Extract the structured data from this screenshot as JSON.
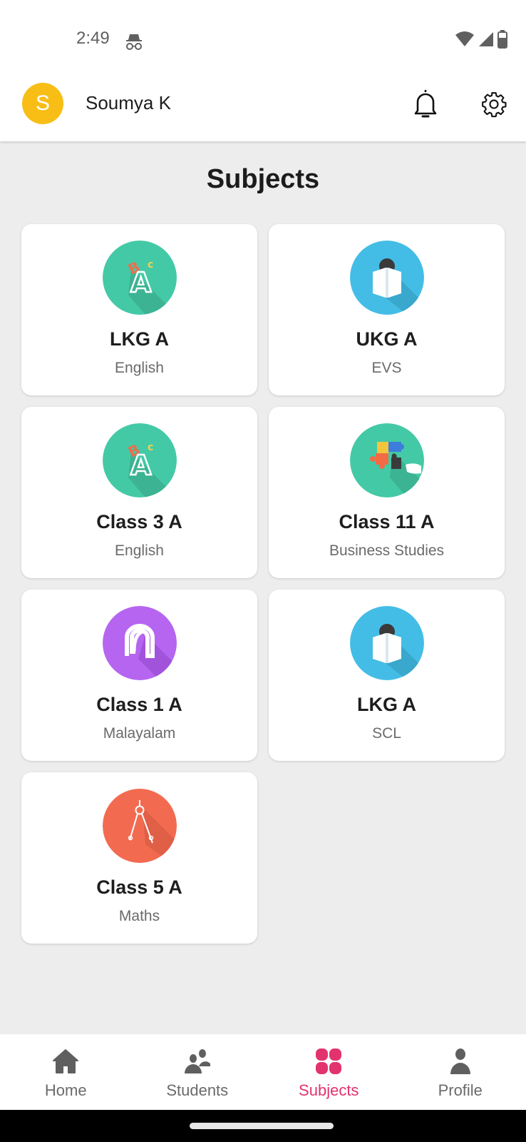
{
  "status_bar": {
    "time": "2:49",
    "icons": [
      "incognito-icon",
      "wifi-icon",
      "signal-icon",
      "battery-icon"
    ]
  },
  "header": {
    "avatar_initial": "S",
    "avatar_color": "#f8be16",
    "user_name": "Soumya K",
    "icons": [
      "bell-icon",
      "gear-icon"
    ]
  },
  "page": {
    "title": "Subjects"
  },
  "subjects": [
    {
      "class": "LKG A",
      "subject": "English",
      "icon": "abc-letters-icon",
      "color": "#44c9a6"
    },
    {
      "class": "UKG A",
      "subject": "EVS",
      "icon": "reading-book-icon",
      "color": "#44bde6"
    },
    {
      "class": "Class 3 A",
      "subject": "English",
      "icon": "abc-letters-icon",
      "color": "#44c9a6"
    },
    {
      "class": "Class 11 A",
      "subject": "Business Studies",
      "icon": "puzzle-icon",
      "color": "#44c9a6"
    },
    {
      "class": "Class 1 A",
      "subject": "Malayalam",
      "icon": "malayalam-letter-icon",
      "color": "#b565ef"
    },
    {
      "class": "LKG A",
      "subject": "SCL",
      "icon": "reading-book-icon",
      "color": "#44bde6"
    },
    {
      "class": "Class 5 A",
      "subject": "Maths",
      "icon": "compass-icon",
      "color": "#f26b50"
    }
  ],
  "bottom_nav": {
    "active_color": "#e2336f",
    "items": [
      {
        "label": "Home",
        "icon": "home-icon"
      },
      {
        "label": "Students",
        "icon": "students-icon"
      },
      {
        "label": "Subjects",
        "icon": "subjects-grid-icon",
        "active": true
      },
      {
        "label": "Profile",
        "icon": "profile-icon"
      }
    ]
  }
}
